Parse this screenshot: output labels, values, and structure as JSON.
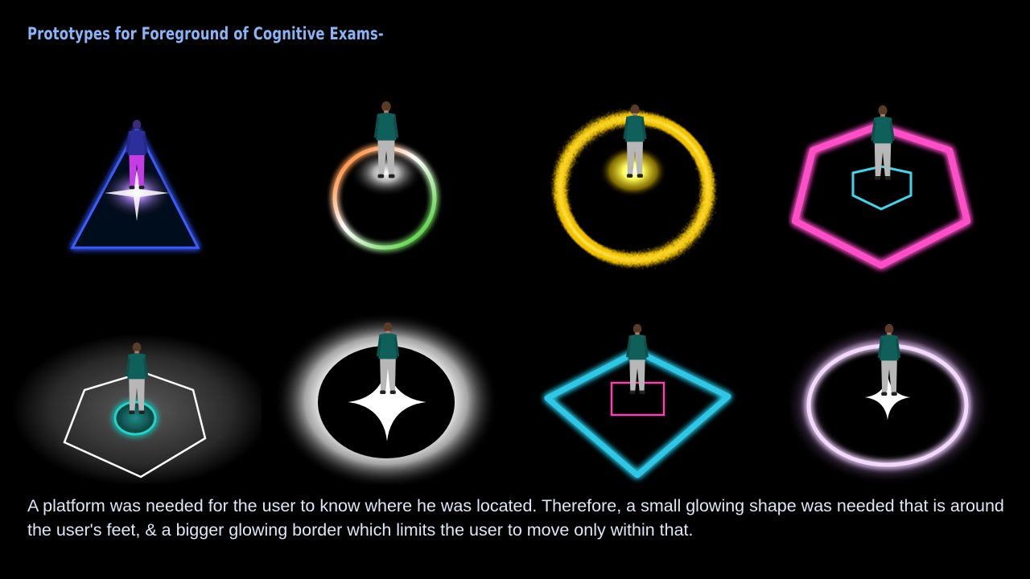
{
  "slide": {
    "title": "Prototypes for Foreground of Cognitive Exams-",
    "caption": "A platform  was needed for the user to know where he was located. Therefore, a small glowing shape was needed that is around the user's feet, & a bigger glowing border which limits the user to move only within that."
  },
  "prototypes": [
    {
      "outer_shape": "triangle",
      "outer_color": "#3a5bff",
      "inner_shape": "starburst",
      "inner_color": "#c9a8ff"
    },
    {
      "outer_shape": "circle",
      "outer_color": "#ffffff",
      "gradient": [
        "#ff7a00",
        "#35c21a"
      ],
      "inner_shape": "radial-glow",
      "inner_color": "#ffffff"
    },
    {
      "outer_shape": "fiery-ring",
      "outer_color": "#ffcc00",
      "inner_shape": "radial-glow",
      "inner_color": "#ffff66"
    },
    {
      "outer_shape": "hexagon",
      "outer_color": "#ff4fc8",
      "inner_shape": "hexagon",
      "inner_color": "#3fd6ea"
    },
    {
      "outer_shape": "hexagon",
      "outer_color": "#ffffff",
      "inner_shape": "circle",
      "inner_color": "#22d3c8"
    },
    {
      "outer_shape": "dark-disc-halo",
      "outer_color": "#ffffff",
      "inner_shape": "four-point-star",
      "inner_color": "#ffffff"
    },
    {
      "outer_shape": "diamond",
      "outer_color": "#2ec8e6",
      "inner_shape": "square",
      "inner_color": "#ff3fb0"
    },
    {
      "outer_shape": "circle",
      "outer_color": "#f3d8ff",
      "inner_shape": "four-point-star",
      "inner_color": "#ffffff"
    }
  ]
}
